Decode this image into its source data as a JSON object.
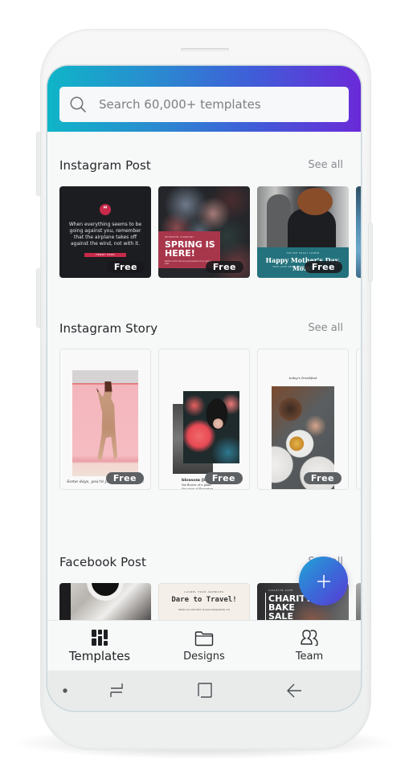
{
  "search": {
    "placeholder": "Search 60,000+ templates",
    "value": "",
    "icon": "search-icon"
  },
  "colors": {
    "header_gradient_start": "#0fb5c8",
    "header_gradient_end": "#6a2ad8",
    "fab_gradient_start": "#1fa6d6",
    "fab_gradient_end": "#5a3ad6",
    "accent_red": "#c82a4a"
  },
  "sections": [
    {
      "title": "Instagram Post",
      "see_all": "See all",
      "cards": [
        {
          "badge": "Free",
          "quote_icon": "“",
          "text": "When everything seems to be going against you, remember that the airplane takes off against the wind, not with it.",
          "author": "HENRY FORD"
        },
        {
          "badge": "Free",
          "small": "WHINSON COMPANY",
          "title": "SPRING IS HERE!",
          "sub": "Watch out for the announcement of our spring sale"
        },
        {
          "badge": "Free",
          "small": "YOU'RE TRULY LOVED",
          "title": "Happy Mother's Day, Mom!",
          "sub": "YOUR LOVE AND GUIDANCE MEANS THE WORLD"
        }
      ]
    },
    {
      "title": "Instagram Story",
      "see_all": "See all",
      "cards": [
        {
          "badge": "Free",
          "caption": "Some days, you're just walking on air."
        },
        {
          "badge": "Free",
          "caption_title": "blossom [bloss-uhm]",
          "caption": "the flower of a plant\nthe state of flowering\nto flourish; develop"
        },
        {
          "badge": "Free",
          "label": "today's breakfast"
        }
      ]
    },
    {
      "title": "Facebook Post",
      "see_all": "See all",
      "cards": [
        {},
        {
          "small": "LAUREL TOUR AGENCIES",
          "title": "Dare to Travel!",
          "sub": "Details and information at www.reallygreatsite.com"
        },
        {
          "small": "VIOLETTE CAFE",
          "title": "CHARITY BAKE SALE"
        }
      ]
    }
  ],
  "fab": {
    "icon": "plus-icon",
    "label": "+"
  },
  "bottom_nav": {
    "items": [
      {
        "label": "Templates",
        "icon": "templates-grid-icon",
        "active": true
      },
      {
        "label": "Designs",
        "icon": "folder-icon",
        "active": false
      },
      {
        "label": "Team",
        "icon": "team-icon",
        "active": false
      }
    ]
  },
  "softkeys": [
    {
      "icon": "dot-icon"
    },
    {
      "icon": "recent-apps-icon"
    },
    {
      "icon": "home-icon"
    },
    {
      "icon": "back-icon"
    }
  ]
}
